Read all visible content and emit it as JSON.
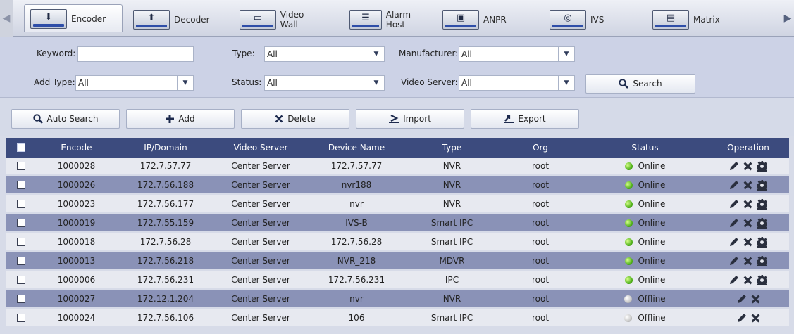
{
  "tabs": [
    {
      "label": "Encoder",
      "icon": "encoder-icon",
      "glyph": "⬇",
      "active": true
    },
    {
      "label": "Decoder",
      "icon": "decoder-icon",
      "glyph": "⬆",
      "active": false
    },
    {
      "label": "Video Wall",
      "icon": "video-wall-icon",
      "glyph": "▭",
      "active": false
    },
    {
      "label": "Alarm Host",
      "icon": "alarm-host-icon",
      "glyph": "☰",
      "active": false
    },
    {
      "label": "ANPR",
      "icon": "anpr-icon",
      "glyph": "▣",
      "active": false
    },
    {
      "label": "IVS",
      "icon": "ivs-icon",
      "glyph": "◎",
      "active": false
    },
    {
      "label": "Matrix",
      "icon": "matrix-icon",
      "glyph": "▤",
      "active": false
    }
  ],
  "filters": {
    "keyword_label": "Keyword:",
    "keyword_value": "",
    "type_label": "Type:",
    "type_value": "All",
    "manufacturer_label": "Manufacturer:",
    "manufacturer_value": "All",
    "add_type_label": "Add Type:",
    "add_type_value": "All",
    "status_label": "Status:",
    "status_value": "All",
    "video_server_label": "Video Server:",
    "video_server_value": "All",
    "search_label": "Search"
  },
  "actions": {
    "auto_search": "Auto Search",
    "add": "Add",
    "delete": "Delete",
    "import": "Import",
    "export": "Export"
  },
  "table": {
    "headers": {
      "encode": "Encode",
      "ip": "IP/Domain",
      "video_server": "Video Server",
      "device_name": "Device Name",
      "type": "Type",
      "org": "Org",
      "status": "Status",
      "operation": "Operation"
    },
    "rows": [
      {
        "encode": "1000028",
        "ip": "172.7.57.77",
        "video_server": "Center Server",
        "device_name": "172.7.57.77",
        "type": "NVR",
        "org": "root",
        "status": "Online"
      },
      {
        "encode": "1000026",
        "ip": "172.7.56.188",
        "video_server": "Center Server",
        "device_name": "nvr188",
        "type": "NVR",
        "org": "root",
        "status": "Online"
      },
      {
        "encode": "1000023",
        "ip": "172.7.56.177",
        "video_server": "Center Server",
        "device_name": "nvr",
        "type": "NVR",
        "org": "root",
        "status": "Online"
      },
      {
        "encode": "1000019",
        "ip": "172.7.55.159",
        "video_server": "Center Server",
        "device_name": "IVS-B",
        "type": "Smart IPC",
        "org": "root",
        "status": "Online"
      },
      {
        "encode": "1000018",
        "ip": "172.7.56.28",
        "video_server": "Center Server",
        "device_name": "172.7.56.28",
        "type": "Smart IPC",
        "org": "root",
        "status": "Online"
      },
      {
        "encode": "1000013",
        "ip": "172.7.56.218",
        "video_server": "Center Server",
        "device_name": "NVR_218",
        "type": "MDVR",
        "org": "root",
        "status": "Online"
      },
      {
        "encode": "1000006",
        "ip": "172.7.56.231",
        "video_server": "Center Server",
        "device_name": "172.7.56.231",
        "type": "IPC",
        "org": "root",
        "status": "Online"
      },
      {
        "encode": "1000027",
        "ip": "172.12.1.204",
        "video_server": "Center Server",
        "device_name": "nvr",
        "type": "NVR",
        "org": "root",
        "status": "Offline"
      },
      {
        "encode": "1000024",
        "ip": "172.7.56.106",
        "video_server": "Center Server",
        "device_name": "106",
        "type": "Smart IPC",
        "org": "root",
        "status": "Offline"
      }
    ]
  },
  "colors": {
    "header_bg": "#3c4b7e",
    "row_light": "#e7e9f0",
    "row_dark": "#8a92b7",
    "online": "#54b41e",
    "offline": "#c8c8c8"
  }
}
